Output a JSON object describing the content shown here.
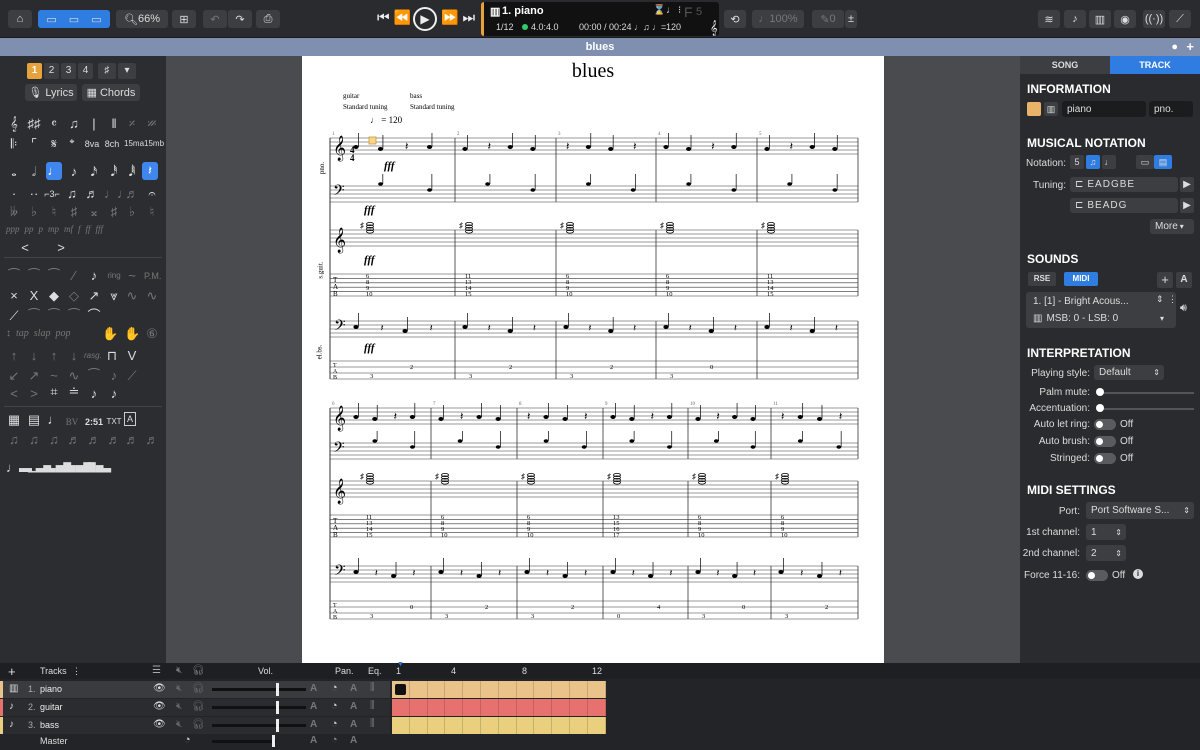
{
  "toolbar": {
    "zoom": "66%",
    "track_title": "1. piano",
    "bar_position": "1/12",
    "time_signature": "4.0:4.0",
    "time": "00:00 / 00:24",
    "tempo": "120",
    "key": "F",
    "key_num": "5",
    "speed": "100%",
    "count": "0"
  },
  "document_title": "blues",
  "left_panel": {
    "voices": [
      "1",
      "2",
      "3",
      "4"
    ],
    "lyrics_label": "Lyrics",
    "chords_label": "Chords",
    "dynamics": [
      "ppp",
      "pp",
      "p",
      "mp",
      "mf",
      "f",
      "ff",
      "fff"
    ],
    "ottava": [
      "8va",
      "8ch",
      "15ma",
      "15mb"
    ],
    "techniques": [
      "tap",
      "slap",
      "pop",
      "rasg."
    ],
    "misc": [
      "BV",
      "2:51",
      "TXT",
      "A"
    ]
  },
  "score": {
    "title": "blues",
    "instruments": [
      {
        "name": "guitar",
        "tuning": "Standard tuning"
      },
      {
        "name": "bass",
        "tuning": "Standard tuning"
      }
    ],
    "tempo_label": "= 120",
    "dynamic": "fff",
    "staff_labels": [
      "pno.",
      "s.guit.",
      "el.bs."
    ],
    "tab_row1_chords": [
      [
        "6",
        "8",
        "9",
        "10"
      ],
      [
        "11",
        "13",
        "14",
        "15"
      ],
      [
        "6",
        "8",
        "9",
        "10"
      ],
      [
        "6",
        "8",
        "9",
        "10"
      ],
      [
        "11",
        "13",
        "14",
        "15"
      ]
    ],
    "tab_row2_chords": [
      [
        "11",
        "13",
        "14",
        "15"
      ],
      [
        "6",
        "8",
        "9",
        "10"
      ],
      [
        "6",
        "8",
        "9",
        "10"
      ],
      [
        "13",
        "15",
        "16",
        "17"
      ],
      [
        "6",
        "8",
        "9",
        "10"
      ],
      [
        "6",
        "8",
        "9",
        "10"
      ]
    ],
    "bass_row1": [
      "3",
      "2",
      "3",
      "2",
      "3",
      "2",
      "3",
      "0"
    ],
    "bass_row2": [
      "3",
      "0",
      "3",
      "2",
      "3",
      "2",
      "0",
      "4",
      "3",
      "0",
      "3",
      "2"
    ],
    "measure_nums_row1": [
      "1",
      "2",
      "3",
      "4",
      "5"
    ],
    "measure_nums_row2": [
      "6",
      "7",
      "8",
      "9",
      "10",
      "11"
    ]
  },
  "right_panel": {
    "tabs": [
      "SONG",
      "TRACK"
    ],
    "information": {
      "heading": "INFORMATION",
      "name": "piano",
      "short": "pno."
    },
    "notation": {
      "heading": "MUSICAL NOTATION",
      "notation_label": "Notation:",
      "tuning_label": "Tuning:",
      "tuning1": "EADGBE",
      "tuning2": "BEADG",
      "more": "More"
    },
    "sounds": {
      "heading": "SOUNDS",
      "rse": "RSE",
      "midi": "MIDI",
      "instrument": "1. [1] - Bright Acous...",
      "bank": "MSB: 0 - LSB: 0"
    },
    "interpretation": {
      "heading": "INTERPRETATION",
      "playing_style_label": "Playing style:",
      "playing_style": "Default",
      "palm_mute": "Palm mute:",
      "accentuation": "Accentuation:",
      "auto_let_ring": "Auto let ring:",
      "auto_brush": "Auto brush:",
      "stringed": "Stringed:",
      "off": "Off"
    },
    "midi": {
      "heading": "MIDI SETTINGS",
      "port_label": "Port:",
      "port": "Port Software S...",
      "ch1_label": "1st channel:",
      "ch1": "1",
      "ch2_label": "2nd channel:",
      "ch2": "2",
      "force_label": "Force 11-16:",
      "off": "Off"
    }
  },
  "tracks": {
    "header": "Tracks",
    "vol": "Vol.",
    "pan": "Pan.",
    "eq": "Eq.",
    "bar_markers": [
      "1",
      "4",
      "8",
      "12"
    ],
    "list": [
      {
        "num": "1.",
        "name": "piano",
        "color": "#e9c38a"
      },
      {
        "num": "2.",
        "name": "guitar",
        "color": "#e7716e"
      },
      {
        "num": "3.",
        "name": "bass",
        "color": "#e9cf7e"
      }
    ],
    "master": "Master"
  }
}
